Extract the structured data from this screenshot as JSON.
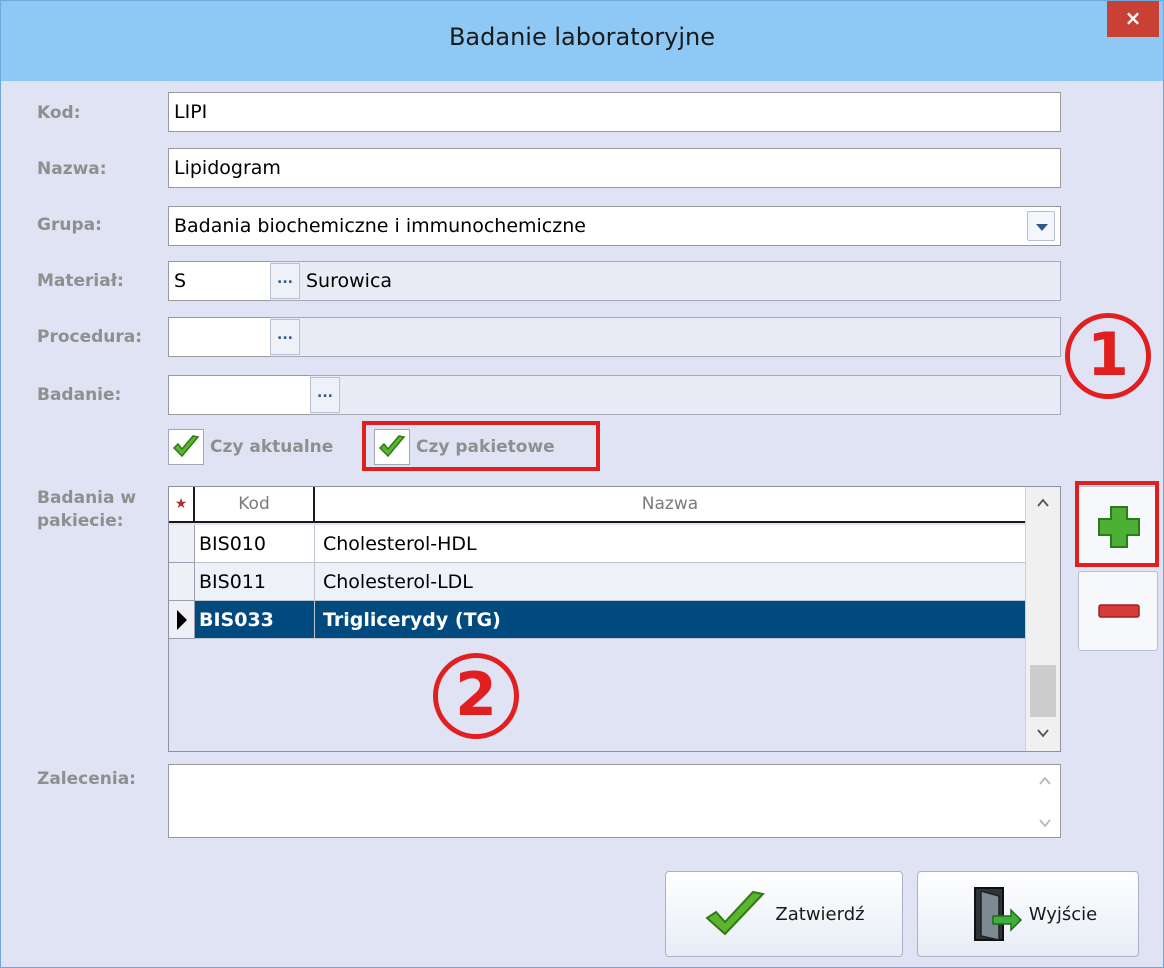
{
  "window": {
    "title": "Badanie laboratoryjne",
    "close_glyph": "×"
  },
  "form": {
    "kod": {
      "label": "Kod:",
      "value": "LIPI"
    },
    "nazwa": {
      "label": "Nazwa:",
      "value": "Lipidogram"
    },
    "grupa": {
      "label": "Grupa:",
      "value": "Badania biochemiczne i immunochemiczne"
    },
    "material": {
      "label": "Materiał:",
      "code": "S",
      "ellipsis": "...",
      "name": "Surowica"
    },
    "procedura": {
      "label": "Procedura:",
      "code": "",
      "ellipsis": "...",
      "name": ""
    },
    "badanie": {
      "label": "Badanie:",
      "code": "",
      "ellipsis": "...",
      "name": ""
    },
    "czy_aktualne": {
      "label": "Czy aktualne",
      "checked": true
    },
    "czy_pakietowe": {
      "label": "Czy pakietowe",
      "checked": true
    },
    "zalecenia": {
      "label": "Zalecenia:",
      "value": ""
    }
  },
  "package": {
    "label_line1": "Badania w",
    "label_line2": "pakiecie:",
    "columns": {
      "star": "★",
      "kod": "Kod",
      "nazwa": "Nazwa"
    },
    "rows": [
      {
        "kod": "BIS010",
        "nazwa": "Cholesterol-HDL",
        "selected": false
      },
      {
        "kod": "BIS011",
        "nazwa": "Cholesterol-LDL",
        "selected": false
      },
      {
        "kod": "BIS033",
        "nazwa": "Triglicerydy (TG)",
        "selected": true
      }
    ]
  },
  "annotations": {
    "one": "1",
    "two": "2",
    "color": "#e02020"
  },
  "buttons": {
    "confirm": "Zatwierdź",
    "exit": "Wyjście"
  },
  "icons": {
    "add": "plus-icon",
    "remove": "minus-icon",
    "check": "checkmark-icon",
    "exit": "door-exit-icon",
    "dropdown": "chevron-down-icon"
  },
  "colors": {
    "selection": "#004a80",
    "title_bar": "#8ec9f6",
    "close": "#c94035",
    "background": "#dfe3f3"
  }
}
